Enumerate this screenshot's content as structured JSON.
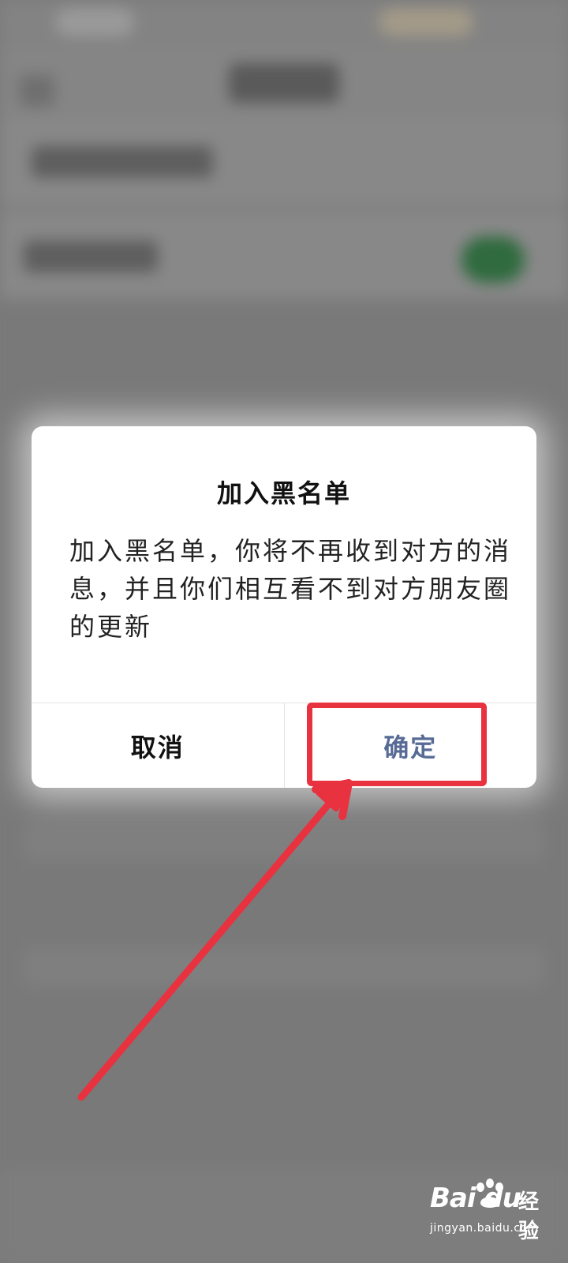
{
  "dialog": {
    "title": "加入黑名单",
    "message": "加入黑名单，你将不再收到对方的消息，并且你们相互看不到对方朋友圈的更新",
    "cancel_label": "取消",
    "confirm_label": "确定"
  },
  "colors": {
    "confirm_text": "#576b95",
    "highlight": "#e8323f",
    "overlay": "#7a7a7a"
  },
  "watermark": {
    "logo": "Bai du",
    "sub": "经验",
    "url": "jingyan.baidu.com"
  }
}
